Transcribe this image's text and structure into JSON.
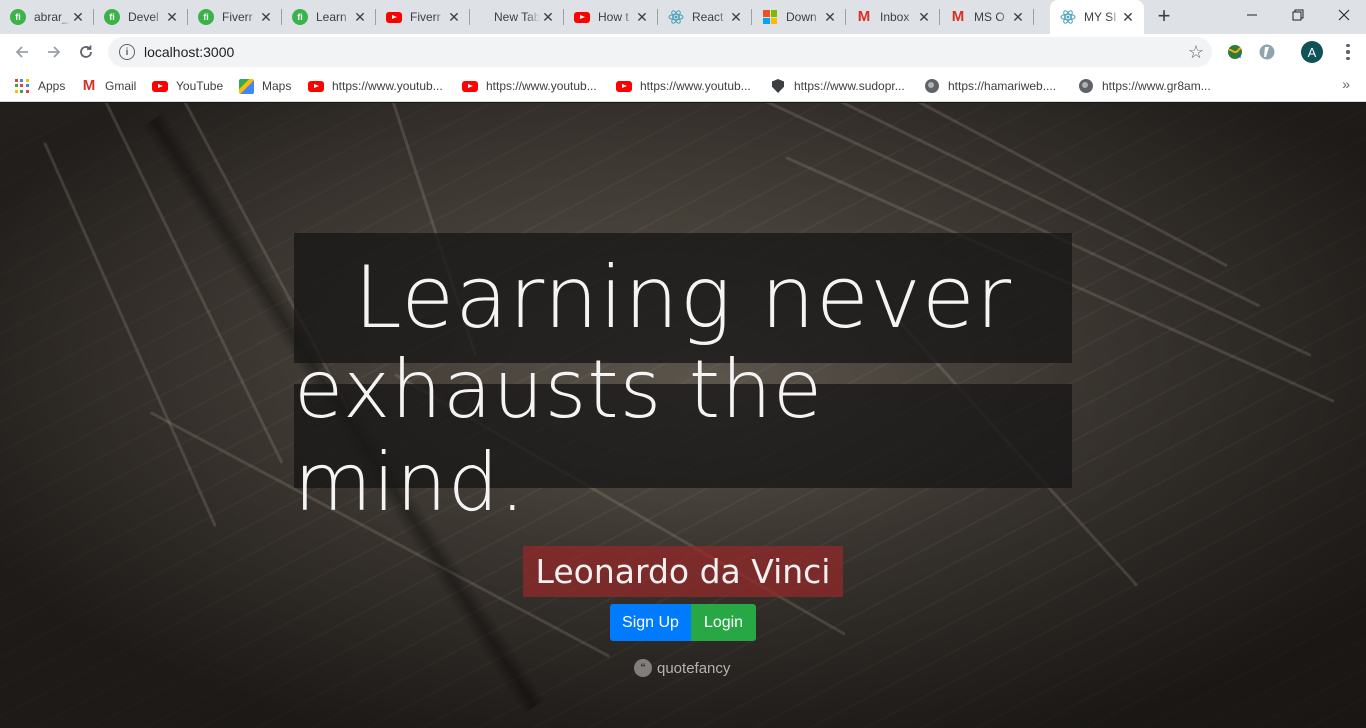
{
  "browser": {
    "tabs": [
      {
        "title": "abrar_",
        "icon": "fiverr-icon"
      },
      {
        "title": "Devel",
        "icon": "fiverr-icon"
      },
      {
        "title": "Fiverr",
        "icon": "fiverr-icon"
      },
      {
        "title": "Learn",
        "icon": "fiverr-icon"
      },
      {
        "title": "Fiverr",
        "icon": "youtube-icon"
      },
      {
        "title": "New Tab",
        "icon": "none"
      },
      {
        "title": "How t",
        "icon": "youtube-icon"
      },
      {
        "title": "React",
        "icon": "react-icon"
      },
      {
        "title": "Down",
        "icon": "microsoft-icon"
      },
      {
        "title": "Inbox",
        "icon": "gmail-icon"
      },
      {
        "title": "MS O",
        "icon": "gmail-icon"
      },
      {
        "title": "MY SI",
        "icon": "react-icon",
        "active": true
      }
    ],
    "new_tab_label": "+",
    "url": "localhost:3000",
    "profile_initial": "A",
    "bookmarks": [
      {
        "label": "Apps",
        "icon": "apps-grid-icon"
      },
      {
        "label": "Gmail",
        "icon": "gmail-icon"
      },
      {
        "label": "YouTube",
        "icon": "youtube-icon"
      },
      {
        "label": "Maps",
        "icon": "maps-icon"
      },
      {
        "label": "https://www.youtub...",
        "icon": "youtube-icon"
      },
      {
        "label": "https://www.youtub...",
        "icon": "youtube-icon"
      },
      {
        "label": "https://www.youtub...",
        "icon": "youtube-icon"
      },
      {
        "label": "https://www.sudopr...",
        "icon": "shield-icon"
      },
      {
        "label": "https://hamariweb....",
        "icon": "globe-icon"
      },
      {
        "label": "https://www.gr8am...",
        "icon": "globe-icon"
      }
    ],
    "colors": {
      "tabstrip": "#dee1e6",
      "youtube": "#ff0000",
      "fiverr": "#3ab44a",
      "gmail": "#d93025",
      "react": "#61dafb",
      "avatar": "#0f5257"
    }
  },
  "page": {
    "quote_line_1": "Learning never",
    "quote_line_2": "exhausts the mind.",
    "author": "Leonardo da Vinci",
    "signup_label": "Sign Up",
    "login_label": "Login",
    "brand": "quotefancy",
    "colors": {
      "signup": "#007bff",
      "login": "#28a745",
      "author_bg": "#962828"
    }
  }
}
